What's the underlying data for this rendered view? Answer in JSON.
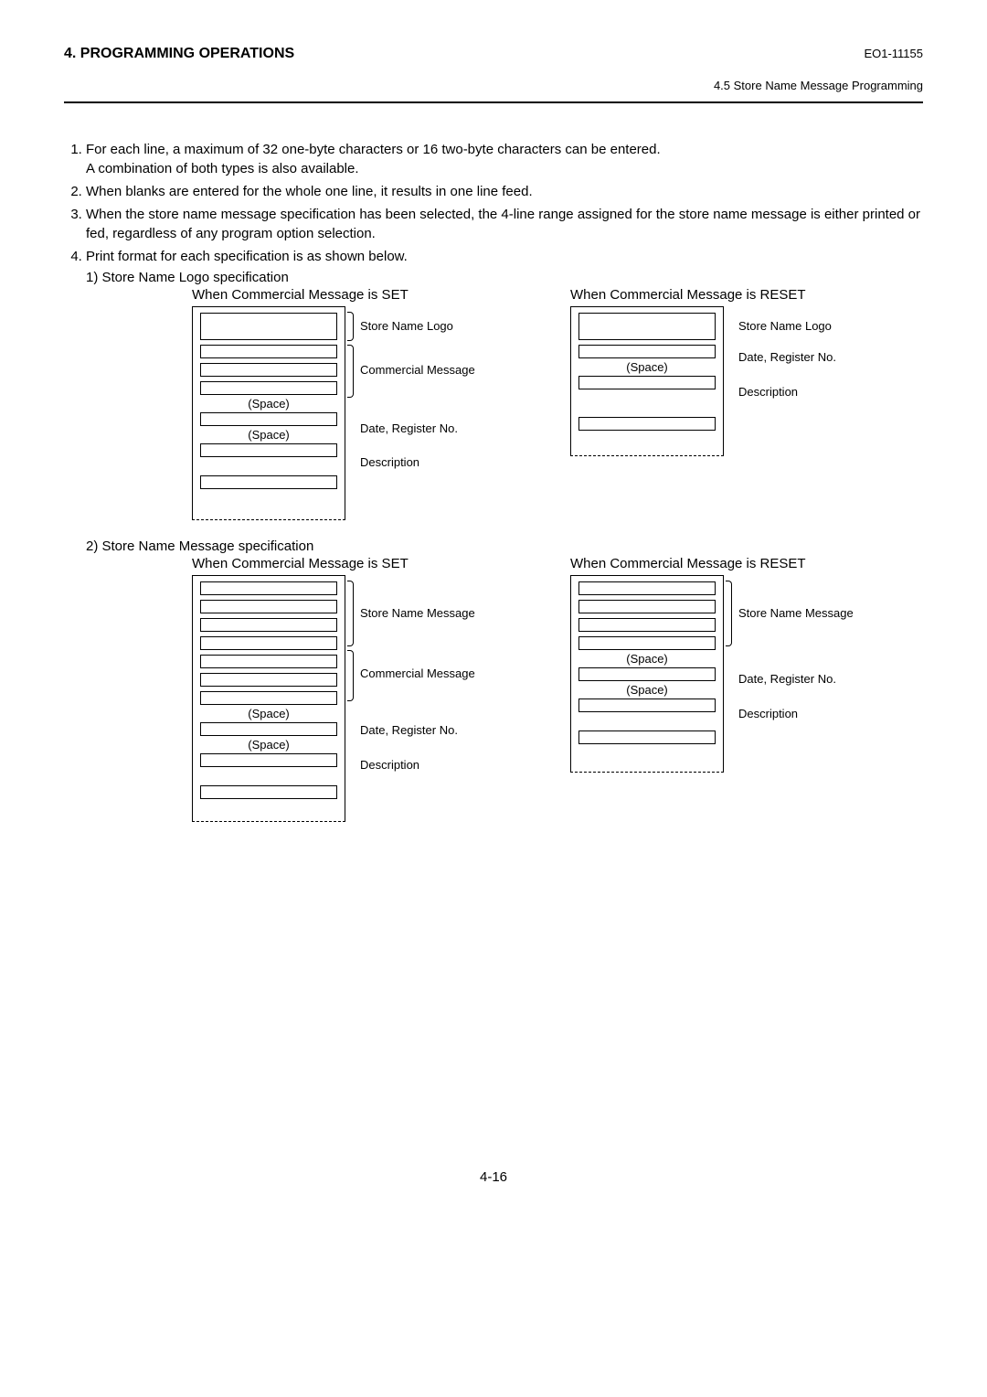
{
  "header": {
    "title": "4. PROGRAMMING OPERATIONS",
    "doc_id": "EO1-11155",
    "section": "4.5 Store Name Message Programming"
  },
  "list": {
    "item1a": "For each line, a maximum of 32 one-byte characters or 16 two-byte characters can be entered.",
    "item1b": "A combination of both types is also available.",
    "item2": "When blanks are entered for the whole one line, it results in one line feed.",
    "item3": "When the store name message specification has been selected, the 4-line range assigned for the store name message is either printed or fed, regardless of any program option selection.",
    "item4": "Print format for each specification is as shown below.",
    "sub4_1": "1) Store Name Logo specification",
    "sub4_2": "2) Store Name Message specification"
  },
  "captions": {
    "set": "When Commercial Message is SET",
    "reset": "When Commercial Message is RESET"
  },
  "labels": {
    "store_logo": "Store Name Logo",
    "store_msg": "Store Name Message",
    "commercial": "Commercial Message",
    "date_reg": "Date, Register No.",
    "description": "Description",
    "space": "(Space)"
  },
  "page_number": "4-16"
}
